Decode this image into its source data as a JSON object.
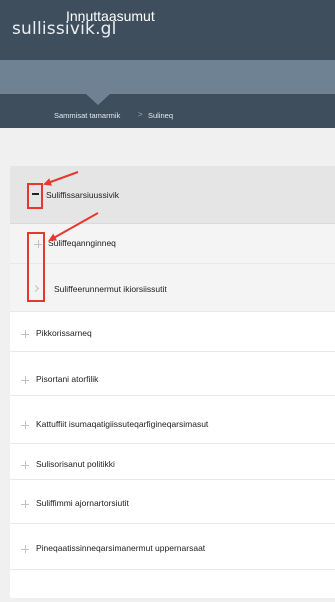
{
  "site": {
    "title": "sullissivik.gl"
  },
  "section": {
    "title": "Innuttaasumut"
  },
  "breadcrumb": {
    "items": [
      "Sammisat tamarmik",
      "Sulineq"
    ],
    "separator": ">"
  },
  "menu": {
    "expanded": {
      "label": "Suliffissarsiuussivik",
      "children": [
        {
          "label": "Suliffeqannginneq",
          "icon": "plus"
        },
        {
          "label": "Suliffeerunnermut ikiorsiissutit",
          "icon": "chevron-right"
        }
      ]
    },
    "items": [
      "Pikkorissarneq",
      "Pisortani atorfilik",
      "Kattuffiit isumaqatigiissuteqarfigineqarsimasut",
      "Sulisorisanut politikki",
      "Suliffimmi ajornartorsiutit",
      "Pineqaatissinneqarsimanermut uppernarsaat"
    ]
  },
  "colors": {
    "topbar": "#3e4e5c",
    "sectionbar": "#6f8293",
    "annotation": "#e5392d"
  }
}
